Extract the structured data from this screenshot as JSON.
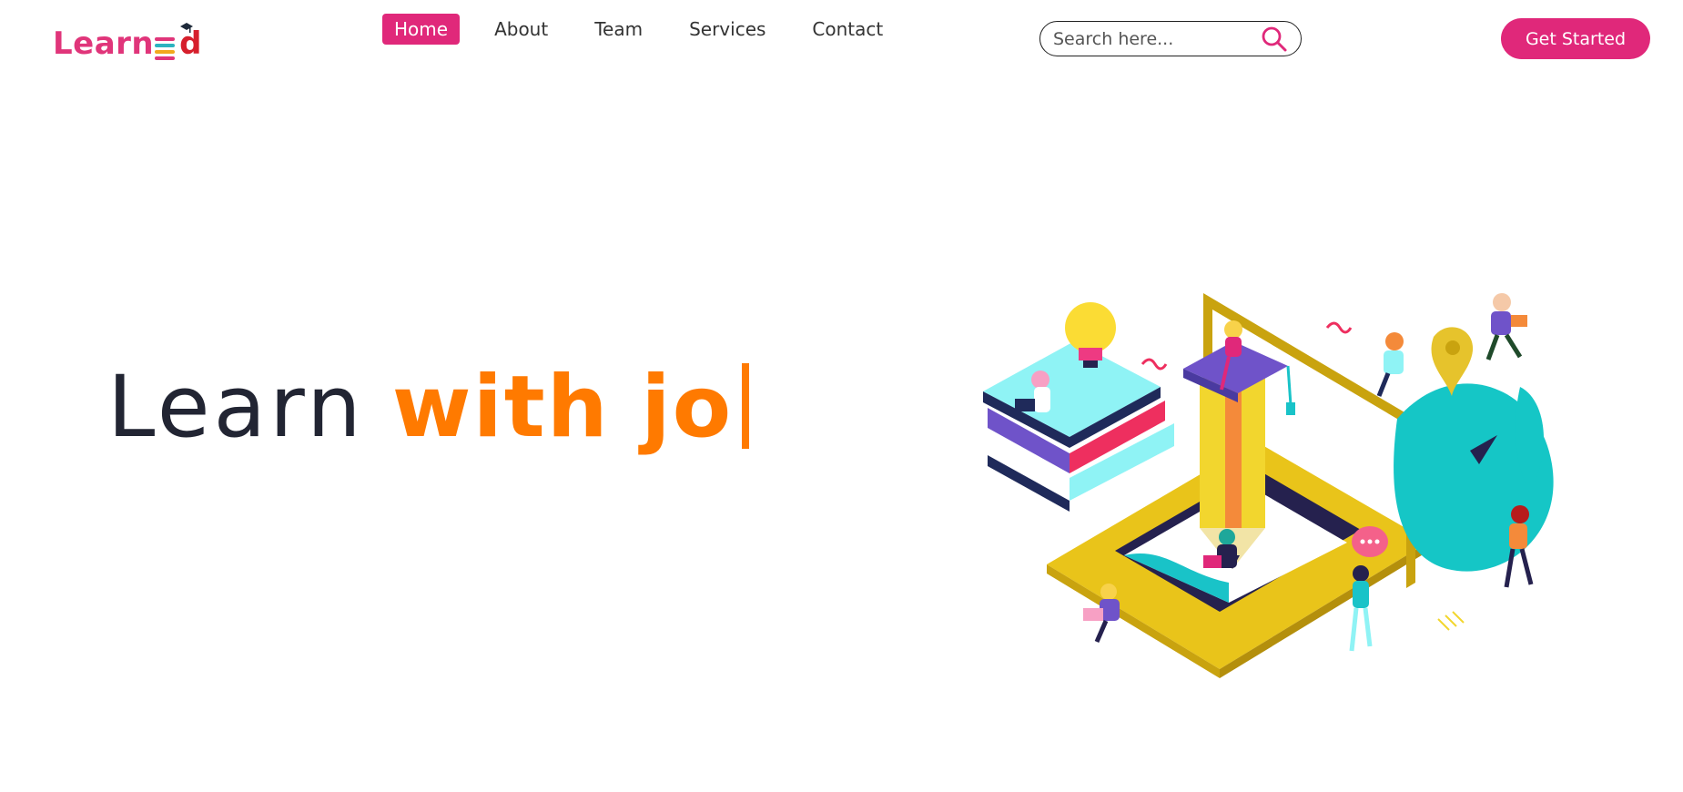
{
  "brand": {
    "name_part": "Learn",
    "name_tail": "d",
    "colors": {
      "primary": "#e0287a",
      "accent": "#ff7a00",
      "dark": "#222533"
    }
  },
  "nav": {
    "items": [
      {
        "label": "Home",
        "active": true
      },
      {
        "label": "About",
        "active": false
      },
      {
        "label": "Team",
        "active": false
      },
      {
        "label": "Services",
        "active": false
      },
      {
        "label": "Contact",
        "active": false
      }
    ]
  },
  "search": {
    "placeholder": "Search here...",
    "icon": "search-icon"
  },
  "cta": {
    "label": "Get Started"
  },
  "hero": {
    "static_text": "Learn",
    "typed_text": "with jo"
  },
  "illustration": {
    "icon": "education-isometric-illustration"
  }
}
